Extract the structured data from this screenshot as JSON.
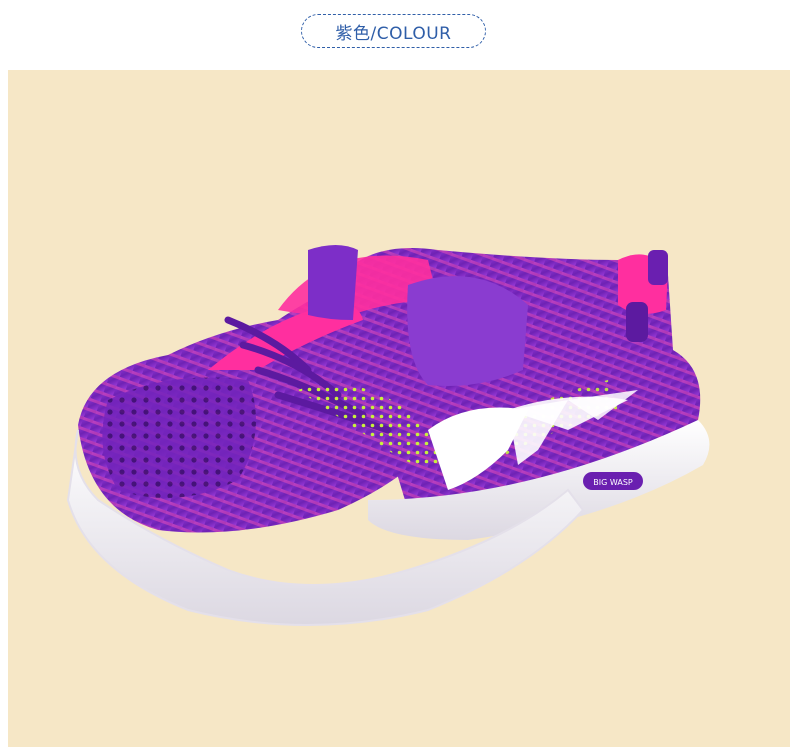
{
  "header": {
    "colour_label": "紫色/COLOUR"
  },
  "product": {
    "brand_mark": "BIG WASP",
    "colors": {
      "background": "#f6e7c6",
      "upper_purple": "#7a2bc0",
      "upper_dark": "#5a1a9a",
      "accent_pink": "#ff2f9f",
      "accent_lime": "#c8f23c",
      "sole": "#f4f2f6",
      "label_blue": "#2f5ea8"
    }
  }
}
